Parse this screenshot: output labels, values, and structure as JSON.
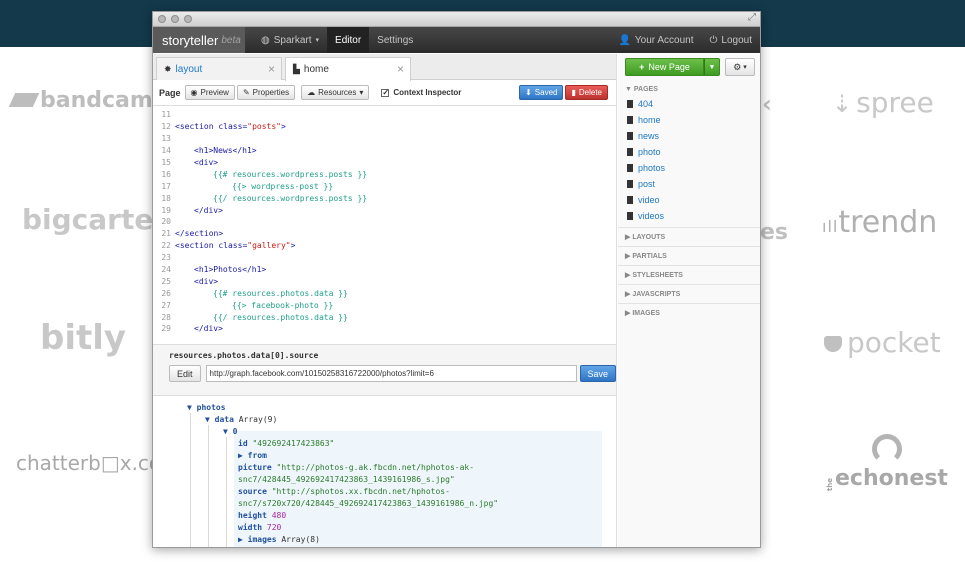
{
  "backdrop": {
    "logos": {
      "bandcamp": "bandcamp",
      "bigcartel": "bigcartel",
      "bitly": "bitly",
      "chatterbox": "chatterb□x.co",
      "spree": "spree",
      "trendn": "trendn",
      "pocket": "pocket",
      "echonest": "echonest",
      "the_small": "the",
      "partial_es": "es"
    }
  },
  "app": {
    "brand": "storyteller",
    "brand_tag": "beta",
    "nav": {
      "sparkart": "Sparkart",
      "editor": "Editor",
      "settings": "Settings",
      "account": "Your Account",
      "logout": "Logout"
    },
    "tabs": [
      {
        "label": "layout"
      },
      {
        "label": "home"
      }
    ],
    "toolbar": {
      "page_label": "Page",
      "preview": "Preview",
      "properties": "Properties",
      "resources": "Resources",
      "context_inspector": "Context Inspector",
      "saved": "Saved",
      "delete": "Delete"
    },
    "code": {
      "l11": "11",
      "l12": "12",
      "l13": "13",
      "l14": "14",
      "l15": "15",
      "l16": "16",
      "l17": "17",
      "l18": "18",
      "l19": "19",
      "l20": "20",
      "l21": "21",
      "l22": "22",
      "l23": "23",
      "l24": "24",
      "l25": "25",
      "l26": "26",
      "l27": "27",
      "l28": "28",
      "l29": "29",
      "section_open": "<section ",
      "class_attr": "class=",
      "posts_val": "\"posts\"",
      "close_gt": ">",
      "h1_news": "<h1>News</h1>",
      "div_open": "<div>",
      "posts_each": "{{# resources.wordpress.posts }}",
      "wp_partial": "{{> wordpress-post }}",
      "posts_end": "{{/ resources.wordpress.posts }}",
      "div_close": "</div>",
      "section_close": "</section>",
      "gallery_val": "\"gallery\"",
      "h1_photos": "<h1>Photos</h1>",
      "photos_each": "{{# resources.photos.data }}",
      "fb_partial": "{{> facebook-photo }}",
      "photos_end": "{{/ resources.photos.data }}"
    },
    "inspector": {
      "path": "resources.photos.data[0].source",
      "edit": "Edit",
      "url_value": "http://graph.facebook.com/10150258316722000/photos?limit=6",
      "save": "Save"
    },
    "tree": {
      "photos": "▼ photos",
      "data_key": "▼ data",
      "data_type": "Array(9)",
      "idx0": "▼ 0",
      "id_key": "id",
      "id_val": "\"492692417423863\"",
      "from": "▶ from",
      "picture_key": "picture",
      "picture_val1": "\"http://photos-g.ak.fbcdn.net/hphotos-ak-",
      "picture_val2": "snc7/428445_492692417423863_1439161986_s.jpg\"",
      "source_key": "source",
      "source_val1": "\"http://sphotos.xx.fbcdn.net/hphotos-",
      "source_val2": "snc7/s720x720/428445_492692417423863_1439161986_n.jpg\"",
      "height_key": "height",
      "height_val": "480",
      "width_key": "width",
      "width_val": "720",
      "images_key": "▶ images",
      "images_val": "Array(8)"
    },
    "sidebar": {
      "new_page": "New Page",
      "pages_header": "▼ PAGES",
      "pages": [
        "404",
        "home",
        "news",
        "photo",
        "photos",
        "post",
        "video",
        "videos"
      ],
      "layouts": "▶ LAYOUTS",
      "partials": "▶ PARTIALS",
      "stylesheets": "▶ STYLESHEETS",
      "javascripts": "▶ JAVASCRIPTS",
      "images": "▶ IMAGES"
    }
  }
}
